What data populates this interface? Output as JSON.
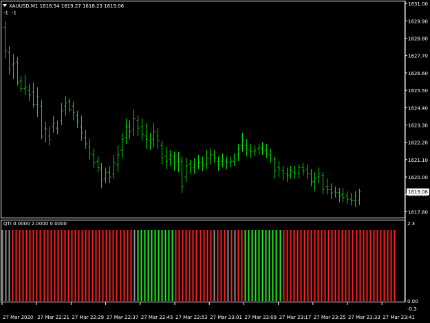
{
  "main_window": {
    "header": "XAUUSD,M1  1618.54 1619.27 1618.23 1619.06",
    "sub_labels": [
      "-1",
      "-1"
    ],
    "price_labels": [
      "1631.00",
      "1629.90",
      "1628.80",
      "1627.70",
      "1626.60",
      "1625.50",
      "1624.40",
      "1623.30",
      "1622.20",
      "1621.10",
      "1620.00",
      "1618.90",
      "1617.80"
    ],
    "price_range": [
      1617.6,
      1631.05
    ],
    "current_price": "1619.06",
    "current_price_value": 1619.06
  },
  "indicator_window": {
    "header": "QTI 0.0000 2.0000 0.0000",
    "scale_labels": [
      "2.3",
      "0.00",
      "-0.3"
    ],
    "colors": {
      "red": "#ff2020",
      "green": "#22ee22",
      "gray": "#909090"
    },
    "bars": [
      "gray",
      "gray",
      "gray",
      "red",
      "red",
      "red",
      "red",
      "red",
      "red",
      "red",
      "red",
      "red",
      "red",
      "red",
      "red",
      "red",
      "red",
      "red",
      "red",
      "red",
      "red",
      "red",
      "red",
      "red",
      "red",
      "red",
      "red",
      "red",
      "red",
      "red",
      "red",
      "red",
      "red",
      "red",
      "red",
      "red",
      "red",
      "red",
      "gray",
      "green",
      "green",
      "green",
      "green",
      "green",
      "green",
      "green",
      "green",
      "green",
      "green",
      "green",
      "red",
      "red",
      "red",
      "red",
      "red",
      "red",
      "red",
      "red",
      "red",
      "red",
      "red",
      "gray",
      "red",
      "red",
      "red",
      "gray",
      "red",
      "gray",
      "red",
      "red",
      "green",
      "green",
      "green",
      "green",
      "green",
      "green",
      "green",
      "green",
      "green",
      "green",
      "green",
      "red",
      "red",
      "red",
      "red",
      "red",
      "red",
      "red",
      "red",
      "red",
      "red",
      "red",
      "red",
      "red",
      "red",
      "red",
      "red",
      "red",
      "red",
      "red",
      "red",
      "red",
      "red",
      "red",
      "red",
      "red",
      "red",
      "red",
      "red",
      "red",
      "red",
      "red",
      "red",
      "red"
    ]
  },
  "time_axis": {
    "labels": [
      "27 Mar 2020",
      "27 Mar 22:21",
      "27 Mar 22:29",
      "27 Mar 22:37",
      "27 Mar 22:45",
      "27 Mar 22:53",
      "27 Mar 23:01",
      "27 Mar 23:09",
      "27 Mar 23:17",
      "27 Mar 23:25",
      "27 Mar 23:33",
      "27 Mar 23:41"
    ]
  },
  "chart_data": {
    "type": "ohlc",
    "symbol": "XAUUSD",
    "timeframe": "M1",
    "bar_color": "#00e000",
    "ylim": [
      1617.6,
      1631.05
    ],
    "bars": [
      [
        1629.5,
        1629.9,
        1627.5,
        1628.0
      ],
      [
        1627.9,
        1628.3,
        1626.5,
        1626.8
      ],
      [
        1627.1,
        1627.8,
        1626.2,
        1627.2
      ],
      [
        1627.3,
        1627.6,
        1625.8,
        1626.0
      ],
      [
        1626.1,
        1626.4,
        1625.4,
        1625.6
      ],
      [
        1625.6,
        1626.5,
        1625.2,
        1625.7
      ],
      [
        1625.5,
        1625.9,
        1624.8,
        1625.2
      ],
      [
        1625.4,
        1626.0,
        1624.4,
        1624.6
      ],
      [
        1624.6,
        1625.7,
        1623.8,
        1625.1
      ],
      [
        1624.5,
        1624.9,
        1622.4,
        1622.6
      ],
      [
        1623.1,
        1623.5,
        1622.2,
        1623.0
      ],
      [
        1622.6,
        1623.2,
        1622.0,
        1622.4
      ],
      [
        1623.2,
        1623.9,
        1622.8,
        1623.4
      ],
      [
        1623.1,
        1623.6,
        1622.7,
        1623.0
      ],
      [
        1623.6,
        1624.7,
        1623.3,
        1624.2
      ],
      [
        1624.5,
        1625.1,
        1623.9,
        1624.7
      ],
      [
        1624.8,
        1625.0,
        1624.1,
        1624.3
      ],
      [
        1624.5,
        1624.8,
        1623.6,
        1624.1
      ],
      [
        1623.9,
        1624.2,
        1623.1,
        1623.5
      ],
      [
        1623.2,
        1623.9,
        1622.3,
        1622.8
      ],
      [
        1622.5,
        1623.0,
        1621.8,
        1622.1
      ],
      [
        1621.9,
        1622.4,
        1621.1,
        1621.5
      ],
      [
        1621.4,
        1621.8,
        1620.6,
        1620.9
      ],
      [
        1621.0,
        1621.3,
        1620.3,
        1620.6
      ],
      [
        1620.5,
        1620.9,
        1619.3,
        1619.8
      ],
      [
        1619.9,
        1620.6,
        1619.6,
        1620.3
      ],
      [
        1620.3,
        1620.7,
        1619.6,
        1620.0
      ],
      [
        1620.2,
        1621.4,
        1619.9,
        1620.9
      ],
      [
        1620.8,
        1622.0,
        1620.3,
        1621.4
      ],
      [
        1621.7,
        1622.8,
        1621.2,
        1622.4
      ],
      [
        1622.5,
        1623.7,
        1622.1,
        1623.2
      ],
      [
        1623.2,
        1623.6,
        1622.4,
        1622.9
      ],
      [
        1623.0,
        1624.3,
        1622.6,
        1623.7
      ],
      [
        1623.6,
        1623.9,
        1622.6,
        1623.1
      ],
      [
        1623.2,
        1623.7,
        1622.3,
        1622.7
      ],
      [
        1622.6,
        1623.4,
        1621.8,
        1622.4
      ],
      [
        1622.3,
        1622.8,
        1621.7,
        1622.2
      ],
      [
        1622.4,
        1623.4,
        1621.9,
        1622.9
      ],
      [
        1622.6,
        1623.1,
        1621.8,
        1622.3
      ],
      [
        1622.0,
        1622.3,
        1620.8,
        1621.2
      ],
      [
        1621.3,
        1621.9,
        1620.5,
        1621.0
      ],
      [
        1621.1,
        1621.7,
        1620.7,
        1621.4
      ],
      [
        1621.3,
        1621.6,
        1620.4,
        1620.9
      ],
      [
        1621.0,
        1621.6,
        1620.3,
        1621.1
      ],
      [
        1621.0,
        1621.3,
        1619.0,
        1619.4
      ],
      [
        1620.0,
        1621.2,
        1619.7,
        1620.7
      ],
      [
        1620.8,
        1621.1,
        1620.2,
        1620.9
      ],
      [
        1620.6,
        1621.2,
        1620.2,
        1620.8
      ],
      [
        1620.9,
        1621.4,
        1620.5,
        1620.9
      ],
      [
        1620.9,
        1621.3,
        1620.4,
        1620.7
      ],
      [
        1620.8,
        1621.7,
        1620.5,
        1621.2
      ],
      [
        1621.2,
        1621.8,
        1620.8,
        1621.4
      ],
      [
        1621.4,
        1621.7,
        1620.9,
        1621.2
      ],
      [
        1621.0,
        1621.3,
        1620.4,
        1620.8
      ],
      [
        1621.0,
        1621.5,
        1620.6,
        1621.1
      ],
      [
        1621.0,
        1621.3,
        1620.5,
        1620.9
      ],
      [
        1620.9,
        1621.3,
        1620.6,
        1621.0
      ],
      [
        1621.0,
        1621.5,
        1620.7,
        1621.2
      ],
      [
        1621.4,
        1622.1,
        1621.0,
        1621.8
      ],
      [
        1622.0,
        1622.8,
        1621.6,
        1622.3
      ],
      [
        1622.0,
        1622.4,
        1621.3,
        1621.8
      ],
      [
        1621.7,
        1622.1,
        1621.2,
        1621.6
      ],
      [
        1621.6,
        1622.0,
        1621.3,
        1621.7
      ],
      [
        1621.8,
        1622.1,
        1621.4,
        1621.9
      ],
      [
        1621.8,
        1622.2,
        1621.4,
        1621.6
      ],
      [
        1621.7,
        1622.1,
        1621.2,
        1621.5
      ],
      [
        1621.4,
        1621.8,
        1620.9,
        1621.2
      ],
      [
        1621.1,
        1621.3,
        1619.9,
        1620.4
      ],
      [
        1620.6,
        1621.0,
        1620.0,
        1620.5
      ],
      [
        1620.4,
        1620.7,
        1619.8,
        1620.2
      ],
      [
        1620.2,
        1620.6,
        1619.7,
        1620.1
      ],
      [
        1620.2,
        1620.7,
        1619.9,
        1620.4
      ],
      [
        1620.3,
        1620.7,
        1619.9,
        1620.2
      ],
      [
        1620.2,
        1620.8,
        1619.9,
        1620.6
      ],
      [
        1620.6,
        1620.9,
        1620.1,
        1620.4
      ],
      [
        1620.5,
        1620.8,
        1619.9,
        1620.2
      ],
      [
        1620.2,
        1620.5,
        1619.4,
        1619.7
      ],
      [
        1619.7,
        1620.3,
        1619.1,
        1619.9
      ],
      [
        1620.0,
        1620.6,
        1619.6,
        1620.2
      ],
      [
        1620.1,
        1620.3,
        1618.9,
        1619.2
      ],
      [
        1619.4,
        1619.9,
        1618.9,
        1619.2
      ],
      [
        1619.2,
        1619.6,
        1618.6,
        1619.0
      ],
      [
        1619.1,
        1619.4,
        1618.7,
        1619.0
      ],
      [
        1619.0,
        1619.3,
        1618.4,
        1618.8
      ],
      [
        1618.9,
        1619.3,
        1618.4,
        1618.7
      ],
      [
        1618.8,
        1619.1,
        1618.3,
        1618.6
      ],
      [
        1618.6,
        1619.0,
        1618.2,
        1618.5
      ],
      [
        1618.5,
        1619.1,
        1618.1,
        1618.8
      ],
      [
        1618.54,
        1619.27,
        1618.23,
        1619.06
      ]
    ]
  }
}
